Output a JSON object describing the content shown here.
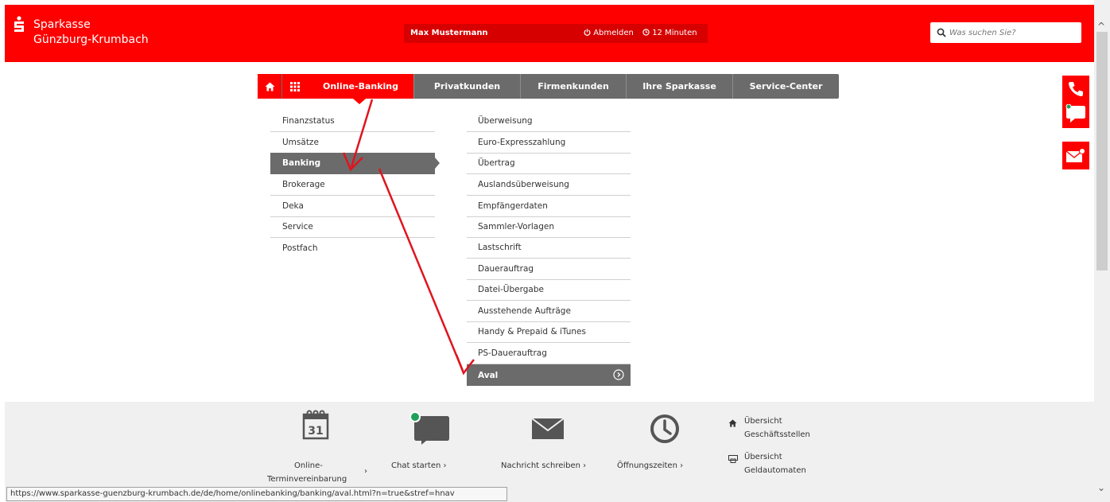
{
  "header": {
    "brand_line1": "Sparkasse",
    "brand_line2": "Günzburg-Krumbach",
    "user_name": "Max Mustermann",
    "logout_label": "Abmelden",
    "timer_label": "12 Minuten",
    "search_placeholder": "Was suchen Sie?"
  },
  "nav": {
    "items": [
      {
        "label": "Online-Banking"
      },
      {
        "label": "Privatkunden"
      },
      {
        "label": "Firmenkunden"
      },
      {
        "label": "Ihre Sparkasse"
      },
      {
        "label": "Service-Center"
      }
    ]
  },
  "submenu_level1": [
    {
      "label": "Finanzstatus"
    },
    {
      "label": "Umsätze"
    },
    {
      "label": "Banking"
    },
    {
      "label": "Brokerage"
    },
    {
      "label": "Deka"
    },
    {
      "label": "Service"
    },
    {
      "label": "Postfach"
    }
  ],
  "submenu_level2": [
    {
      "label": "Überweisung"
    },
    {
      "label": "Euro-Expresszahlung"
    },
    {
      "label": "Übertrag"
    },
    {
      "label": "Auslandsüberweisung"
    },
    {
      "label": "Empfängerdaten"
    },
    {
      "label": "Sammler-Vorlagen"
    },
    {
      "label": "Lastschrift"
    },
    {
      "label": "Dauerauftrag"
    },
    {
      "label": "Datei-Übergabe"
    },
    {
      "label": "Ausstehende Aufträge"
    },
    {
      "label": "Handy & Prepaid & iTunes"
    },
    {
      "label": "PS-Dauerauftrag"
    },
    {
      "label": "Aval"
    }
  ],
  "footer": {
    "calendar_day": "31",
    "appointment_line1": "Online-",
    "appointment_line2": "Terminvereinbarung",
    "chat_label": "Chat starten",
    "message_label": "Nachricht schreiben",
    "hours_label": "Öffnungszeiten",
    "branches_line1": "Übersicht",
    "branches_line2": "Geschäftsstellen",
    "atm_line1": "Übersicht",
    "atm_line2": "Geldautomaten",
    "chevron": "›"
  },
  "status_url": "https://www.sparkasse-guenzburg-krumbach.de/de/home/onlinebanking/banking/aval.html?n=true&stref=hnav",
  "colors": {
    "brand_red": "#ff0000",
    "nav_gray": "#6b6b6b",
    "footer_bg": "#f0f0f0",
    "annotation_arrow": "#e0141e",
    "chat_online": "#1fa15a"
  }
}
